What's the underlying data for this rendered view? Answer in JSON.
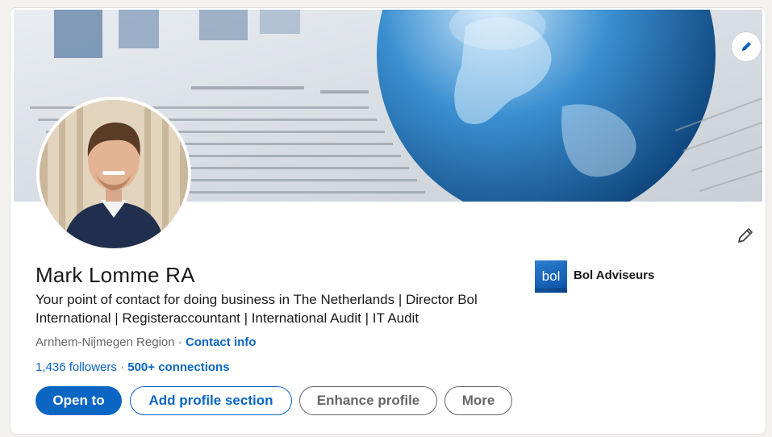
{
  "profile": {
    "name": "Mark Lomme RA",
    "headline": "Your point of contact for doing business in The Netherlands | Director Bol International | Registeraccountant | International Audit | IT Audit",
    "location": "Arnhem-Nijmegen Region",
    "location_separator": "·",
    "contact_info_label": "Contact info",
    "followers_label": "1,436 followers",
    "connections_separator": "·",
    "connections_label": "500+ connections"
  },
  "company": {
    "logo_text": "bol",
    "name": "Bol Adviseurs"
  },
  "actions": {
    "open_to": "Open to",
    "add_section": "Add profile section",
    "enhance": "Enhance profile",
    "more": "More"
  },
  "colors": {
    "accent": "#0a66c2",
    "text": "#191919",
    "muted": "#666666"
  },
  "icons": {
    "banner_edit": "pencil-icon",
    "intro_edit": "pencil-icon"
  }
}
